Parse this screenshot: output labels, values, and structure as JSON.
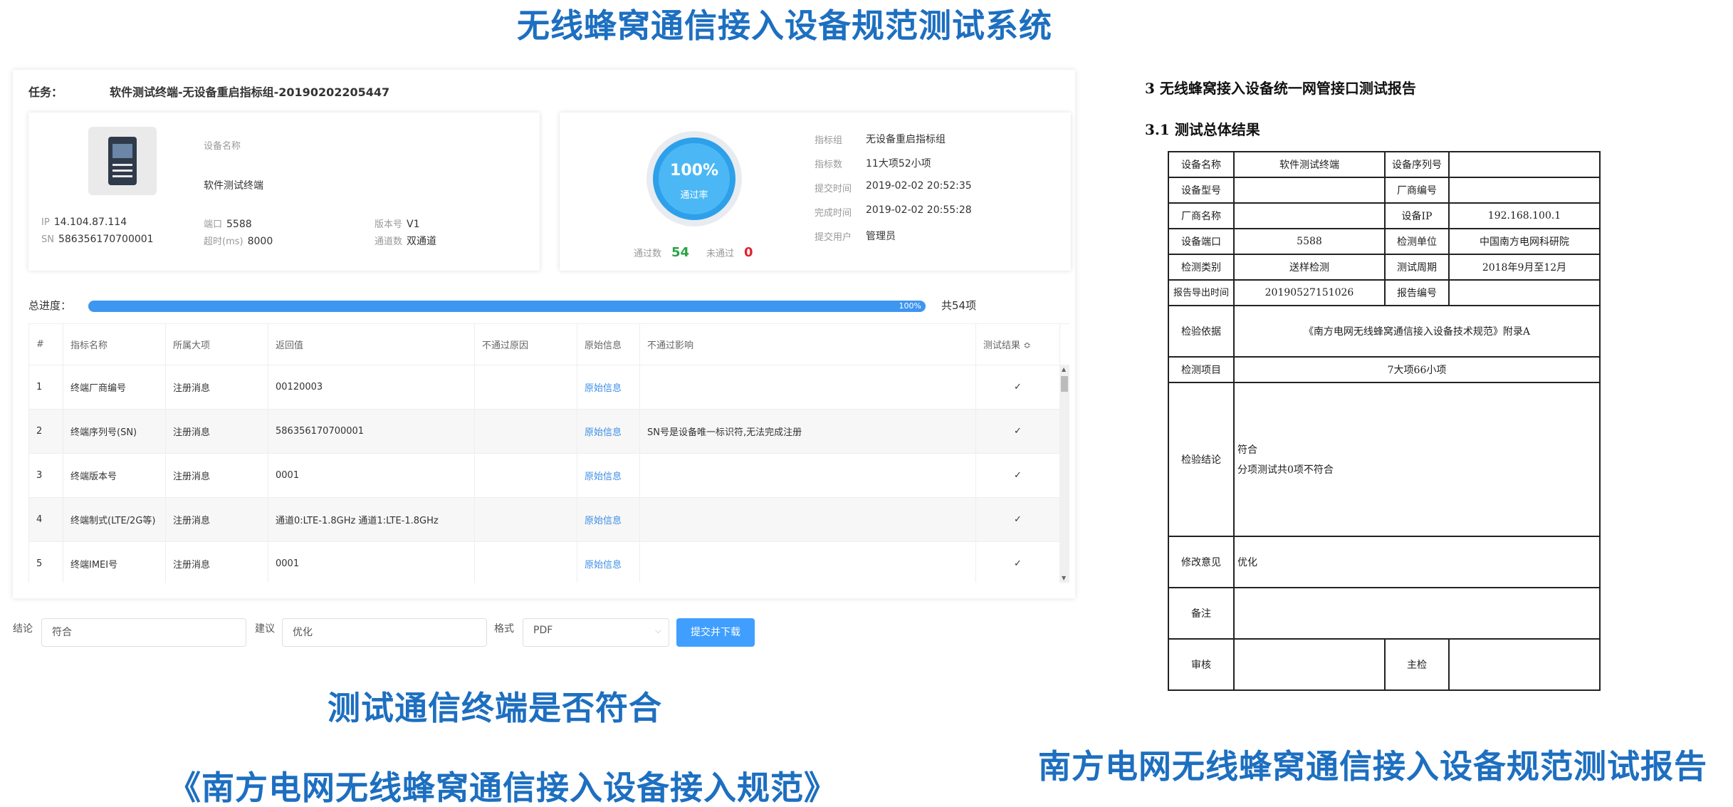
{
  "headlines": {
    "main": "无线蜂窝通信接入设备规范测试系统",
    "sub1": "测试通信终端是否符合",
    "sub2": "《南方电网无线蜂窝通信接入设备接入规范》",
    "sub3": "南方电网无线蜂窝通信接入设备规范测试报告"
  },
  "task": {
    "label": "任务：",
    "value": "软件测试终端-无设备重启指标组-20190202205447"
  },
  "device": {
    "name_label": "设备名称",
    "name": "软件测试终端",
    "ip_label": "IP",
    "ip": "14.104.87.114",
    "sn_label": "SN",
    "sn": "586356170700001",
    "port_label": "端口",
    "port": "5588",
    "timeout_label": "超时(ms)",
    "timeout": "8000",
    "version_label": "版本号",
    "version": "V1",
    "channels_label": "通道数",
    "channels": "双通道"
  },
  "summary": {
    "pass_rate": "100%",
    "pass_rate_label": "通过率",
    "pass_label": "通过数",
    "pass_count": "54",
    "fail_label": "未通过",
    "fail_count": "0",
    "group_label": "指标组",
    "group": "无设备重启指标组",
    "count_label": "指标数",
    "count": "11大项52小项",
    "submit_label": "提交时间",
    "submit_time": "2019-02-02 20:52:35",
    "finish_label": "完成时间",
    "finish_time": "2019-02-02 20:55:28",
    "user_label": "提交用户",
    "user": "管理员"
  },
  "progress": {
    "label": "总进度：",
    "value_pct": 100,
    "text": "100%",
    "total": "共54项"
  },
  "table": {
    "headers": [
      "#",
      "指标名称",
      "所属大项",
      "返回值",
      "不通过原因",
      "原始信息",
      "不通过影响",
      "测试结果 ≎"
    ],
    "rows": [
      {
        "no": "1",
        "name": "终端厂商编号",
        "group": "注册消息",
        "value": "00120003",
        "reason": "",
        "raw": "原始信息",
        "impact": ""
      },
      {
        "no": "2",
        "name": "终端序列号(SN)",
        "group": "注册消息",
        "value": "586356170700001",
        "reason": "",
        "raw": "原始信息",
        "impact": "SN号是设备唯一标识符,无法完成注册"
      },
      {
        "no": "3",
        "name": "终端版本号",
        "group": "注册消息",
        "value": "0001",
        "reason": "",
        "raw": "原始信息",
        "impact": ""
      },
      {
        "no": "4",
        "name": "终端制式(LTE/2G等)",
        "group": "注册消息",
        "value": "通道0:LTE-1.8GHz 通道1:LTE-1.8GHz",
        "reason": "",
        "raw": "原始信息",
        "impact": ""
      },
      {
        "no": "5",
        "name": "终端IMEI号",
        "group": "注册消息",
        "value": "0001",
        "reason": "",
        "raw": "原始信息",
        "impact": ""
      }
    ]
  },
  "form": {
    "conclusion_label": "结论",
    "conclusion": "符合",
    "advice_label": "建议",
    "advice": "优化",
    "format_label": "格式",
    "format": "PDF",
    "submit": "提交并下载"
  },
  "report": {
    "title": "3 无线蜂窝接入设备统一网管接口测试报告",
    "section": "3.1 测试总体结果",
    "device_name_label": "设备名称",
    "device_name": "软件测试终端",
    "serial_label": "设备序列号",
    "serial": "",
    "model_label": "设备型号",
    "model": "",
    "vendor_code_label": "厂商编号",
    "vendor_code": "",
    "vendor_name_label": "厂商名称",
    "vendor_name": "",
    "ip_label": "设备IP",
    "ip": "192.168.100.1",
    "port_label": "设备端口",
    "port": "5588",
    "unit_label": "检测单位",
    "unit": "中国南方电网科研院",
    "category_label": "检测类别",
    "category": "送样检测",
    "period_label": "测试周期",
    "period": "2018年9月至12月",
    "export_label": "报告导出时间",
    "export_time": "20190527151026",
    "report_no_label": "报告编号",
    "report_no": "",
    "basis_label": "检验依据",
    "basis": "《南方电网无线蜂窝通信接入设备技术规范》附录A",
    "items_label": "检测项目",
    "items": "7大项66小项",
    "conclusion_label": "检验结论",
    "conclusion_line1": "符合",
    "conclusion_line2": "分项测试共0项不符合",
    "advice_label": "修改意见",
    "advice": "优化",
    "remark_label": "备注",
    "remark": "",
    "review_label": "审核",
    "review": "",
    "inspect_label": "主检",
    "inspect": ""
  }
}
